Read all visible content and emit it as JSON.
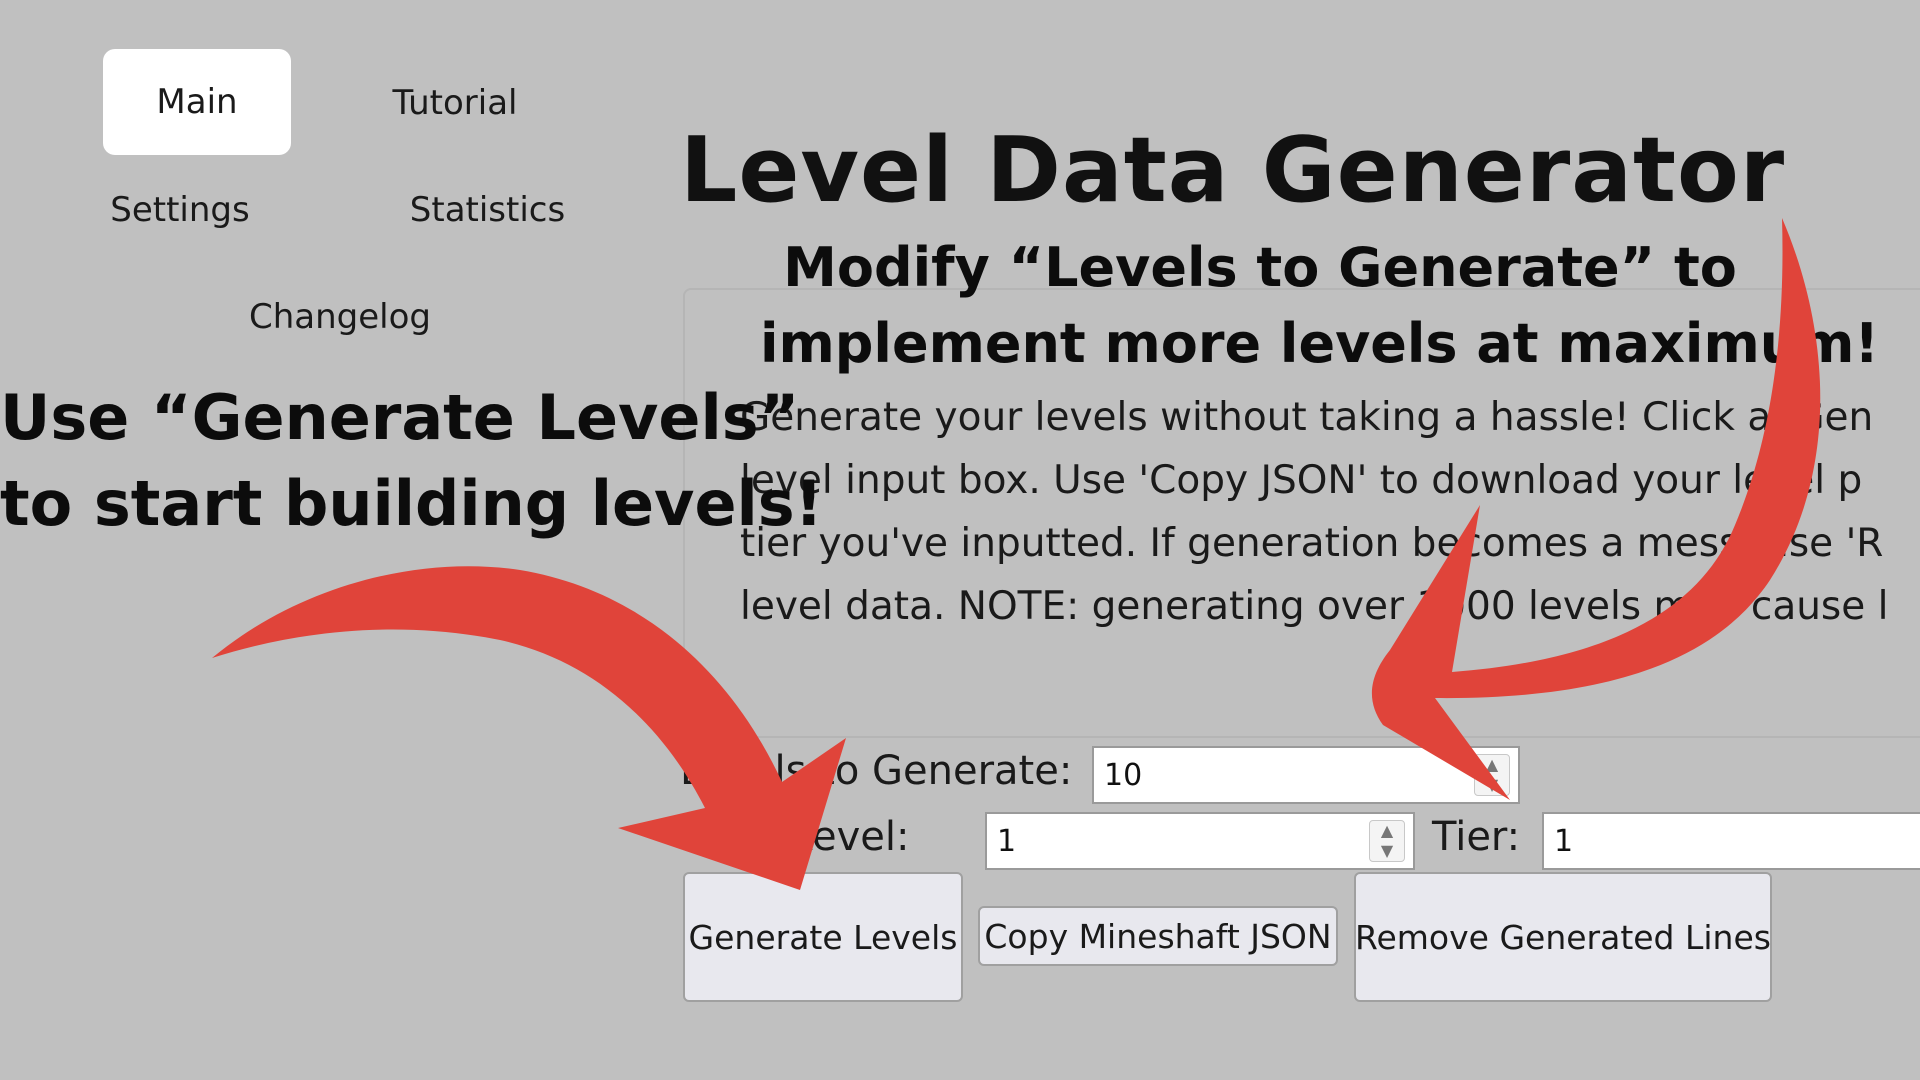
{
  "nav": {
    "main": "Main",
    "tutorial": "Tutorial",
    "settings": "Settings",
    "statistics": "Statistics",
    "changelog": "Changelog"
  },
  "page_title": "Level Data Generator",
  "description_lines": [
    "Generate your levels without taking a hassle! Click a 'Gen",
    "level input box. Use 'Copy JSON' to download your level p",
    "tier you've inputted. If generation becomes a mess, use 'R",
    "level data. NOTE: generating over 1000 levels may cause l"
  ],
  "form": {
    "levels_to_generate_label": "Levels to Generate:",
    "levels_to_generate_value": "10",
    "start_level_label": "Start Level:",
    "start_level_value": "1",
    "tier_label": "Tier:",
    "tier_value": "1"
  },
  "buttons": {
    "generate": "Generate Levels",
    "copy_json": "Copy Mineshaft JSON",
    "remove": "Remove Generated Lines"
  },
  "annotations": {
    "right_line1": "Modify “Levels to Generate” to",
    "right_line2": "implement more levels at maximum!",
    "left_line1": "Use “Generate Levels”",
    "left_line2": "to start building levels!"
  },
  "colors": {
    "background": "#c0c0c0",
    "arrow": "#e0443a",
    "button": "#e8e8ee"
  }
}
